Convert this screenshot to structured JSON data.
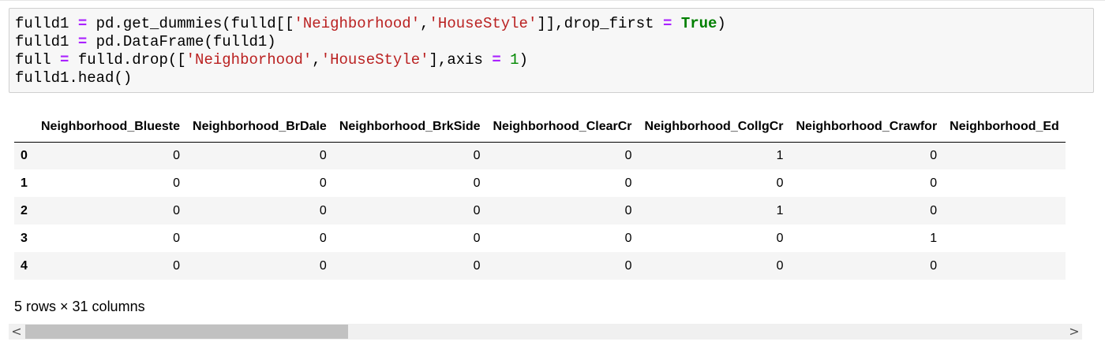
{
  "cell": {
    "code_lines": [
      "fulld1 = pd.get_dummies(fulld[['Neighborhood','HouseStyle']],drop_first = True)",
      "fulld1 = pd.DataFrame(fulld1)",
      "full = fulld.drop(['Neighborhood','HouseStyle'],axis = 1)",
      "fulld1.head()"
    ]
  },
  "output": {
    "columns": [
      "Neighborhood_Blueste",
      "Neighborhood_BrDale",
      "Neighborhood_BrkSide",
      "Neighborhood_ClearCr",
      "Neighborhood_CollgCr",
      "Neighborhood_Crawfor",
      "Neighborhood_Ed"
    ],
    "rows": [
      {
        "index": "0",
        "values": [
          "0",
          "0",
          "0",
          "0",
          "1",
          "0",
          ""
        ]
      },
      {
        "index": "1",
        "values": [
          "0",
          "0",
          "0",
          "0",
          "0",
          "0",
          ""
        ]
      },
      {
        "index": "2",
        "values": [
          "0",
          "0",
          "0",
          "0",
          "1",
          "0",
          ""
        ]
      },
      {
        "index": "3",
        "values": [
          "0",
          "0",
          "0",
          "0",
          "0",
          "1",
          ""
        ]
      },
      {
        "index": "4",
        "values": [
          "0",
          "0",
          "0",
          "0",
          "0",
          "0",
          ""
        ]
      }
    ],
    "shape_text": "5 rows × 31 columns"
  },
  "scrollbar": {
    "left_arrow": "<",
    "right_arrow": ">"
  }
}
